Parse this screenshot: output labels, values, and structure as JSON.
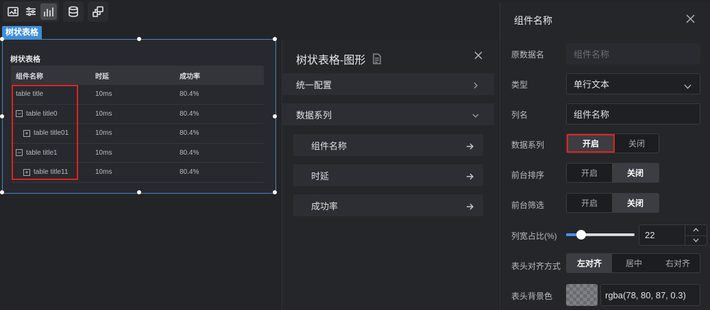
{
  "toolbar": {
    "icons": [
      "image-icon",
      "sliders-icon",
      "bar-chart-icon",
      "database-icon",
      "interaction-icon"
    ]
  },
  "widget": {
    "tag": "树状表格",
    "title": "树状表格",
    "columns": [
      "组件名称",
      "时延",
      "成功率"
    ],
    "rows": [
      {
        "name": "table title",
        "delay": "10ms",
        "rate": "80.4%",
        "level": 0,
        "toggle": ""
      },
      {
        "name": "table title0",
        "delay": "10ms",
        "rate": "80.4%",
        "level": 0,
        "toggle": "−"
      },
      {
        "name": "table title01",
        "delay": "10ms",
        "rate": "80.4%",
        "level": 1,
        "toggle": "+"
      },
      {
        "name": "table title1",
        "delay": "10ms",
        "rate": "80.4%",
        "level": 0,
        "toggle": "−"
      },
      {
        "name": "table title11",
        "delay": "10ms",
        "rate": "80.4%",
        "level": 1,
        "toggle": "+"
      }
    ]
  },
  "mid_panel": {
    "title": "树状表格-图形",
    "sections": [
      "统一配置",
      "数据系列"
    ],
    "series_items": [
      "组件名称",
      "时延",
      "成功率"
    ]
  },
  "right_panel": {
    "title": "组件名称",
    "labels": {
      "source_name": "原数据名",
      "type": "类型",
      "column_name": "列名",
      "data_series": "数据系列",
      "front_sort": "前台排序",
      "front_filter": "前台筛选",
      "col_width": "列宽占比(%)",
      "header_align": "表头对齐方式",
      "header_bg": "表头背景色"
    },
    "source_placeholder": "组件名称",
    "type_value": "单行文本",
    "column_name_value": "组件名称",
    "on_label": "开启",
    "off_label": "关闭",
    "data_series_state": "on",
    "front_sort_state": "off",
    "front_filter_state": "off",
    "col_width_value": "22",
    "col_width_fraction": 0.22,
    "align_options": [
      "左对齐",
      "居中",
      "右对齐"
    ],
    "align_selected": "左对齐",
    "header_bg_value": "rgba(78, 80, 87, 0.3)"
  },
  "colors": {
    "accent": "#4d8ef0",
    "highlight": "#e0231b",
    "tag": "#3f8ed8"
  }
}
